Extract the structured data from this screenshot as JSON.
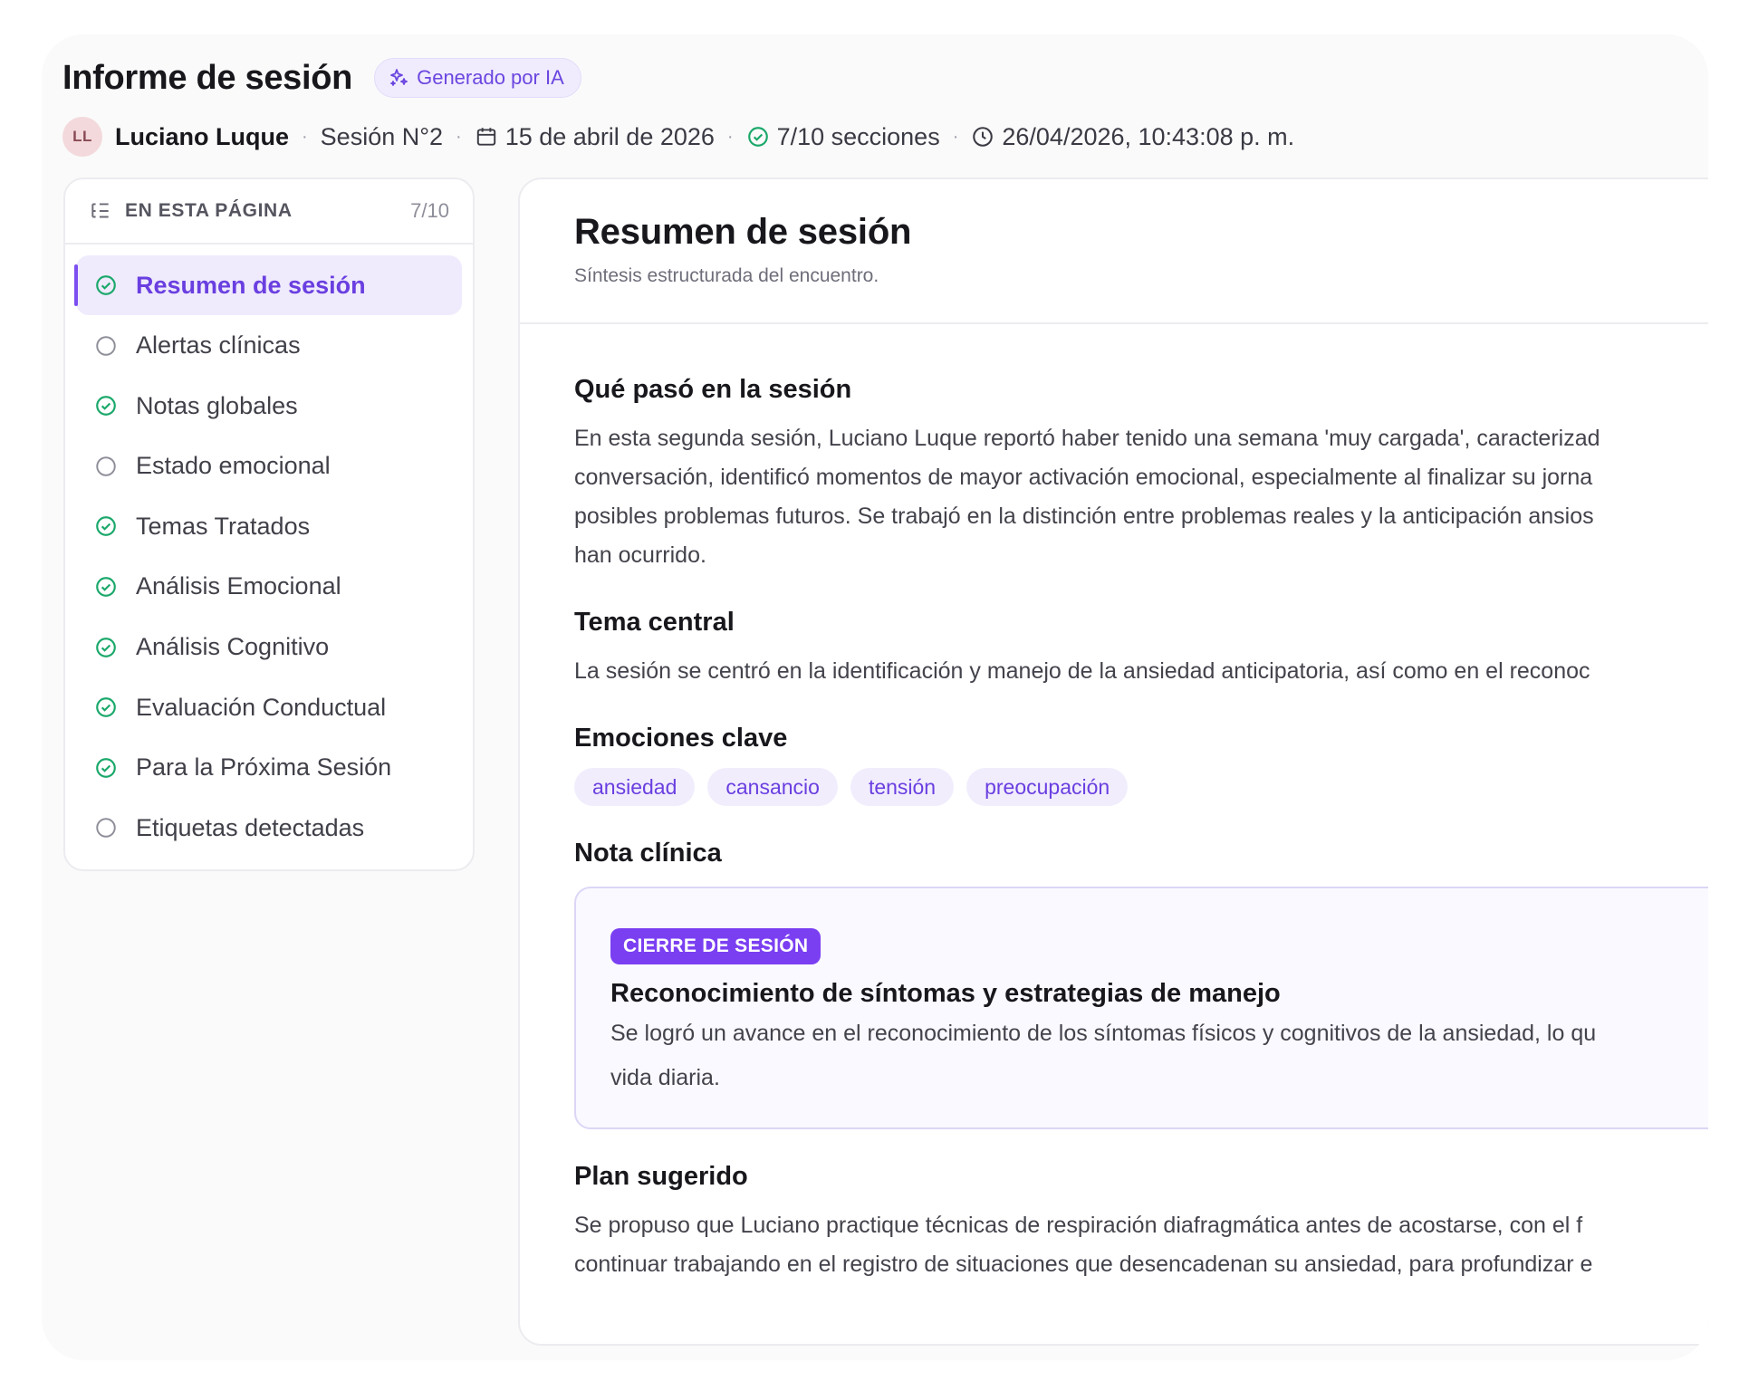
{
  "header": {
    "title": "Informe de sesión",
    "ai_badge": "Generado por IA",
    "avatar_initials": "LL",
    "patient": "Luciano Luque",
    "session": "Sesión N°2",
    "date": "15 de abril de 2026",
    "sections": "7/10 secciones",
    "timestamp": "26/04/2026, 10:43:08 p. m."
  },
  "toc": {
    "heading": "EN ESTA PÁGINA",
    "count": "7/10",
    "items": [
      {
        "label": "Resumen de sesión",
        "done": true
      },
      {
        "label": "Alertas clínicas",
        "done": false
      },
      {
        "label": "Notas globales",
        "done": true
      },
      {
        "label": "Estado emocional",
        "done": false
      },
      {
        "label": "Temas Tratados",
        "done": true
      },
      {
        "label": "Análisis Emocional",
        "done": true
      },
      {
        "label": "Análisis Cognitivo",
        "done": true
      },
      {
        "label": "Evaluación Conductual",
        "done": true
      },
      {
        "label": "Para la Próxima Sesión",
        "done": true
      },
      {
        "label": "Etiquetas detectadas",
        "done": false
      }
    ]
  },
  "main": {
    "title": "Resumen de sesión",
    "subtitle": "Síntesis estructurada del encuentro.",
    "what_happened": {
      "title": "Qué pasó en la sesión",
      "lines": [
        "En esta segunda sesión, Luciano Luque reportó haber tenido una semana 'muy cargada', caracterizad",
        "conversación, identificó momentos de mayor activación emocional, especialmente al finalizar su jorna",
        "posibles problemas futuros. Se trabajó en la distinción entre problemas reales y la anticipación ansios",
        "han ocurrido."
      ]
    },
    "central_theme": {
      "title": "Tema central",
      "lines": [
        "La sesión se centró en la identificación y manejo de la ansiedad anticipatoria, así como en el reconoc"
      ]
    },
    "emotions": {
      "title": "Emociones clave",
      "chips": [
        "ansiedad",
        "cansancio",
        "tensión",
        "preocupación"
      ]
    },
    "clinical_note": {
      "title": "Nota clínica",
      "tag": "CIERRE DE SESIÓN",
      "card_title": "Reconocimiento de síntomas y estrategias de manejo",
      "lines": [
        "Se logró un avance en el reconocimiento de los síntomas físicos y cognitivos de la ansiedad, lo qu",
        "vida diaria."
      ]
    },
    "plan": {
      "title": "Plan sugerido",
      "lines": [
        "Se propuso que Luciano practique técnicas de respiración diafragmática antes de acostarse, con el f",
        "continuar trabajando en el registro de situaciones que desencadenan su ansiedad, para profundizar e"
      ]
    }
  },
  "colors": {
    "accent": "#7b4ff0",
    "check_green": "#1aa86a",
    "empty_circle": "#8e8e9a",
    "chip_bg": "#f1edfd"
  },
  "icons": {
    "ai_badge": "sparkle-icon",
    "toc_heading": "list-tree-icon",
    "date": "calendar-icon",
    "sections": "check-circle-icon",
    "timestamp": "clock-icon",
    "toc_done": "check-circle-icon",
    "toc_pending": "empty-circle-icon"
  }
}
